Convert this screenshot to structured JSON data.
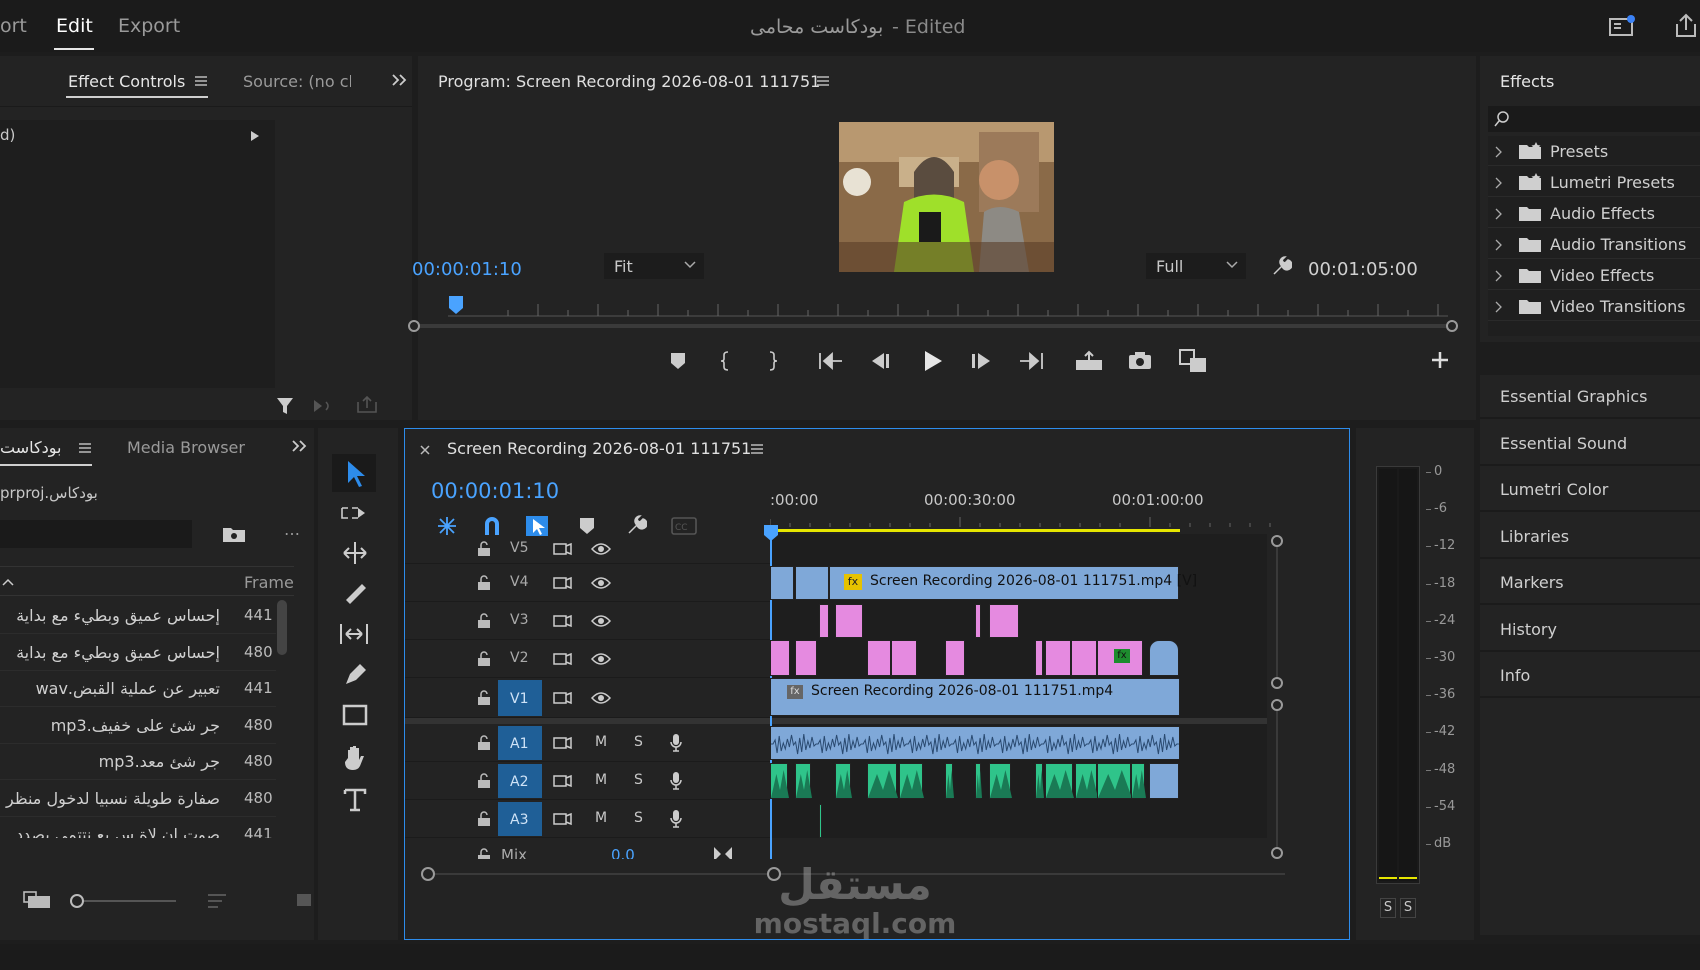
{
  "topbar": {
    "menu_import": "ort",
    "menu_edit": "Edit",
    "menu_export": "Export",
    "doc_title": "بودكاست محامى",
    "doc_state": "- Edited"
  },
  "effect_controls": {
    "tab_label": "Effect Controls",
    "source_tab": "Source: (no cli",
    "clip_row": "d)"
  },
  "program": {
    "title": "Program: Screen Recording 2026-08-01 111751",
    "timecode": "00:00:01:10",
    "fit": "Fit",
    "quality": "Full",
    "duration": "00:01:05:00"
  },
  "effects": {
    "title": "Effects",
    "items": [
      "Presets",
      "Lumetri Presets",
      "Audio Effects",
      "Audio Transitions",
      "Video Effects",
      "Video Transitions"
    ],
    "panels": [
      "Essential Graphics",
      "Essential Sound",
      "Lumetri Color",
      "Libraries",
      "Markers",
      "History",
      "Info"
    ]
  },
  "project": {
    "tab_project": "بودكاست",
    "tab_media": "Media Browser",
    "file": "بودكاس.prproj",
    "col_frame": "Frame",
    "rows": [
      {
        "name": "إحساس عميق وبطيء مع بداية",
        "frame": "441"
      },
      {
        "name": "إحساس عميق وبطيء مع بداية",
        "frame": "480"
      },
      {
        "name": "تعبير عن عملية القبض.wav",
        "frame": "441"
      },
      {
        "name": "جر شئ على خفيف.mp3",
        "frame": "480"
      },
      {
        "name": "جر شئ معد.mp3",
        "frame": "480"
      },
      {
        "name": "صفارة طويلة نسبيا لدخول منظر",
        "frame": "480"
      },
      {
        "name": "صوت ان لاة.س بع نتتمى بصدد",
        "frame": "441"
      }
    ]
  },
  "timeline": {
    "title": "Screen Recording 2026-08-01 111751",
    "timecode": "00:00:01:10",
    "ruler": [
      ":00:00",
      "00:00:30:00",
      "00:01:00:00"
    ],
    "tracks": [
      "V5",
      "V4",
      "V3",
      "V2",
      "V1",
      "A1",
      "A2",
      "A3"
    ],
    "mix_label": "Mix",
    "mix_value": "0.0",
    "clip_v4": "Screen Recording 2026-08-01 111751.mp4 [V]",
    "clip_v1": "Screen Recording 2026-08-01 111751.mp4",
    "fx": "fx",
    "m": "M",
    "s": "S"
  },
  "meter": {
    "scale": [
      "0",
      "-6",
      "-12",
      "-18",
      "-24",
      "-30",
      "-36",
      "-42",
      "-48",
      "-54",
      "dB"
    ],
    "solo": [
      "S",
      "S"
    ]
  },
  "watermark": {
    "arabic": "مستقل",
    "latin": "mostaql.com"
  },
  "colors": {
    "accent": "#2d8ceb",
    "video_clip": "#7fa8d8",
    "pink_clip": "#e58ae0",
    "green_audio": "#2fc48a",
    "playhead": "#4aa3ff",
    "yellow_bar": "#e6e600"
  }
}
